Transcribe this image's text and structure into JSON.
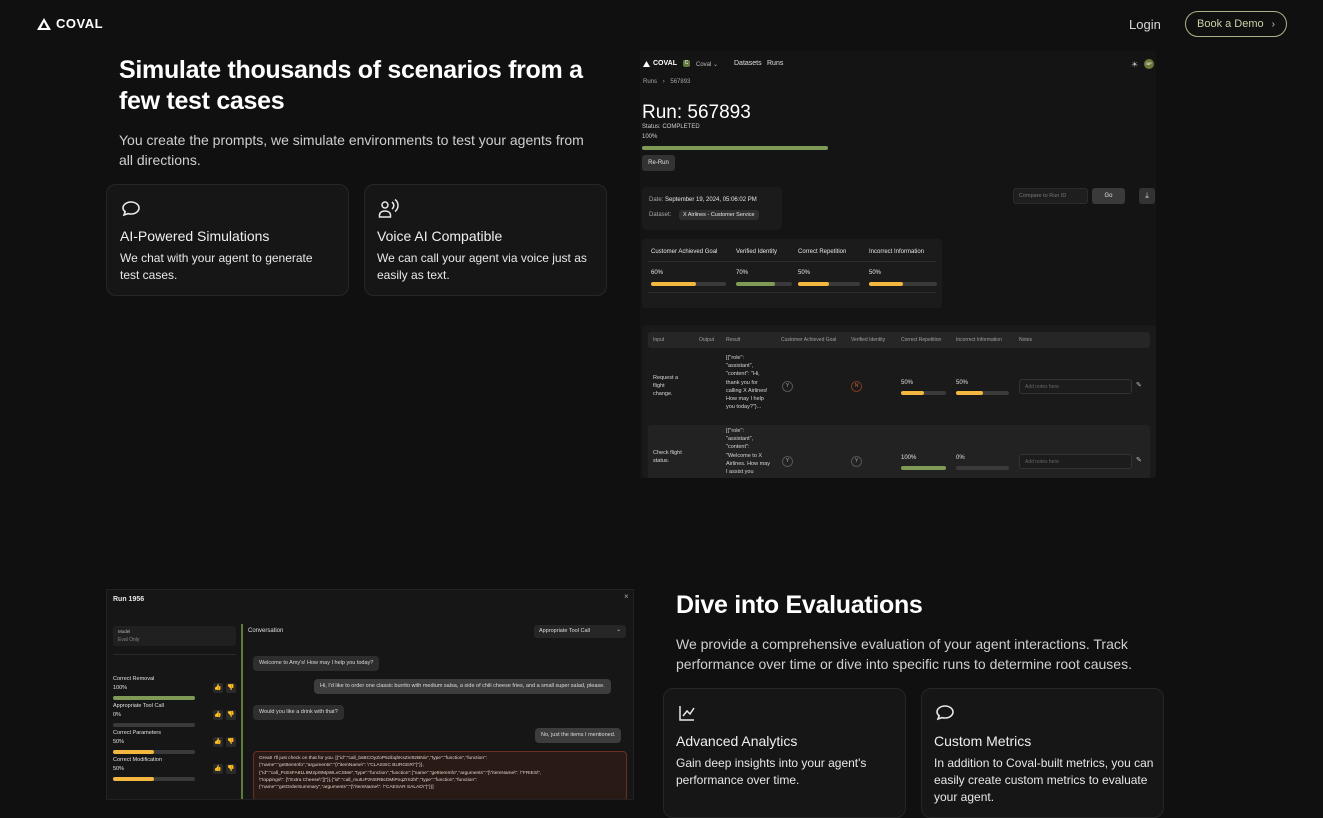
{
  "nav": {
    "brand": "COVAL",
    "login": "Login",
    "cta": "Book a Demo"
  },
  "hero": {
    "title": "Simulate thousands of scenarios from a few test cases",
    "subtitle": "You create the prompts, we simulate environments to test your agents from all directions.",
    "features": [
      {
        "icon": "chat-bubble-icon",
        "title": "AI-Powered Simulations",
        "text": "We chat with your agent to generate test cases."
      },
      {
        "icon": "voice-user-icon",
        "title": "Voice AI Compatible",
        "text": "We can call your agent via voice just as easily as text."
      }
    ]
  },
  "run_app": {
    "brand": "COVAL",
    "org_badge": "C",
    "org": "Coval",
    "nav": [
      "Datasets",
      "Runs"
    ],
    "avatar": "BP",
    "breadcrumb": [
      "Runs",
      "567893"
    ],
    "title": "Run: 567893",
    "status": "Status: COMPLETED",
    "progress_label": "100%",
    "progress": 1.0,
    "rerun": "Re-Run",
    "date_label": "Date:",
    "date_value": "September 19, 2024, 05:06:02 PM",
    "dataset_label": "Dataset:",
    "dataset_value": "X Airlines - Customer Service",
    "compare_placeholder": "Compare to Run ID",
    "go": "Go",
    "metrics": [
      {
        "name": "Customer Achieved Goal",
        "value": "60%",
        "fill": 0.6,
        "color": "#f4b73f"
      },
      {
        "name": "Verified Identity",
        "value": "70%",
        "fill": 0.7,
        "color": "#7e9a56"
      },
      {
        "name": "Correct Repetition",
        "value": "50%",
        "fill": 0.5,
        "color": "#f4b73f"
      },
      {
        "name": "Incorrect Information",
        "value": "50%",
        "fill": 0.5,
        "color": "#f4b73f"
      }
    ],
    "table": {
      "headers": [
        "Input",
        "Output",
        "Result",
        "Customer Achieved Goal",
        "Verified Identity",
        "Correct Repetition",
        "Incorrect Information",
        "Notes"
      ],
      "rows": [
        {
          "input": "Request a flight change.",
          "result": "[{\"role\": \"assistant\", \"content\": \"Hi, thank you for calling X Airlines! How may I help you today?\"}...",
          "goal": "Y",
          "identity": "N",
          "repetition": "50%",
          "rep_fill": 0.5,
          "incorrect": "50%",
          "inc_fill": 0.5,
          "notes_placeholder": "Add notes here"
        },
        {
          "input": "Check flight status.",
          "result": "[{\"role\": \"assistant\", \"content\": \"Welcome to X Airlines. How may I assist you",
          "goal": "Y",
          "identity": "Y",
          "repetition": "100%",
          "rep_fill": 1.0,
          "incorrect": "0%",
          "inc_fill": 0.0,
          "notes_placeholder": "Add notes here"
        }
      ]
    }
  },
  "eval_section": {
    "title": "Dive into Evaluations",
    "subtitle": "We provide a comprehensive evaluation of your agent interactions. Track performance over time or dive into specific runs to determine root causes.",
    "features": [
      {
        "icon": "line-chart-icon",
        "title": "Advanced Analytics",
        "text": "Gain deep insights into your agent's performance over time."
      },
      {
        "icon": "chat-bubble-icon",
        "title": "Custom Metrics",
        "text": "In addition to Coval-built metrics, you can easily create custom metrics to evaluate your agent."
      }
    ]
  },
  "eval_app": {
    "title": "Run 1956",
    "close": "×",
    "model_label": "Model",
    "model_value": "Eval Only",
    "conversation": "Conversation",
    "select": "Appropriate Tool Call",
    "metrics": [
      {
        "name": "Correct Removal",
        "value": "100%",
        "fill": 1.0,
        "color": "#7e9a56"
      },
      {
        "name": "Appropriate Tool Call",
        "value": "0%",
        "fill": 0.0,
        "color": "#7e9a56"
      },
      {
        "name": "Correct Parameters",
        "value": "50%",
        "fill": 0.5,
        "color": "#f4b73f"
      },
      {
        "name": "Correct Modification",
        "value": "50%",
        "fill": 0.5,
        "color": "#f4b73f"
      }
    ],
    "messages": [
      "Welcome to Amy's! How may I help you today?",
      "Hi, I'd like to order one classic burrito with medium salsa, a side of chili cheese fries, and a small super salad, please.",
      "Would you like a drink with that?",
      "No, just the items I mentioned."
    ],
    "tool_message_lines": [
      "Great! I'll just check on that for you. [{\"id\":\"call_bsBCOyZoP5zibqhKsZnr8zBNiv\",\"type\":\"function\",\"function\":",
      "{\"name\":\"getItemInfo\",\"arguments\":\"{\\\"itemName\\\": \\\"CLASSIC BURGER\\\"}\"}},",
      "{\"id\":\"call_PcEsFA81L9M2pr8MpWLvCSMe\",\"type\":\"function\",\"function\":{\"name\":\"getItemInfo\",\"arguments\":\"{\\\"itemName\\\": \\\"FRIES\\\",",
      "\\\"toppings\\\": [\\\"Extra Cheese\\\"]}\"}},{\"id\":\"call_mutUPzNSRBcDMiPnqZrS2hl\",\"type\":\"function\",\"function\":",
      "{\"name\":\"getOrderSummary\",\"arguments\":\"{\\\"itemName\\\": \\\"CAESAR SALAD\\\"}\"}}]"
    ]
  }
}
